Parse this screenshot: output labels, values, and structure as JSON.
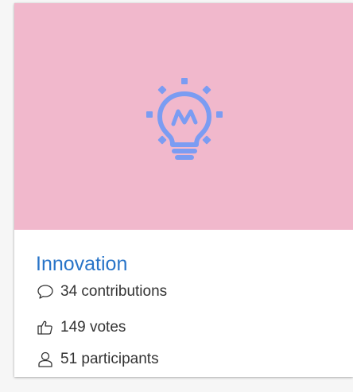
{
  "card": {
    "title": "Innovation",
    "banner_color": "#f1b8cc",
    "icon_color": "#7b9cf2",
    "banner_icon": "lightbulb-icon",
    "stats": {
      "contributions": {
        "icon": "speech-bubble-icon",
        "text": "34 contributions"
      },
      "votes": {
        "icon": "thumbs-up-icon",
        "text": "149 votes"
      },
      "participants": {
        "icon": "person-icon",
        "text": "51 participants"
      }
    }
  }
}
